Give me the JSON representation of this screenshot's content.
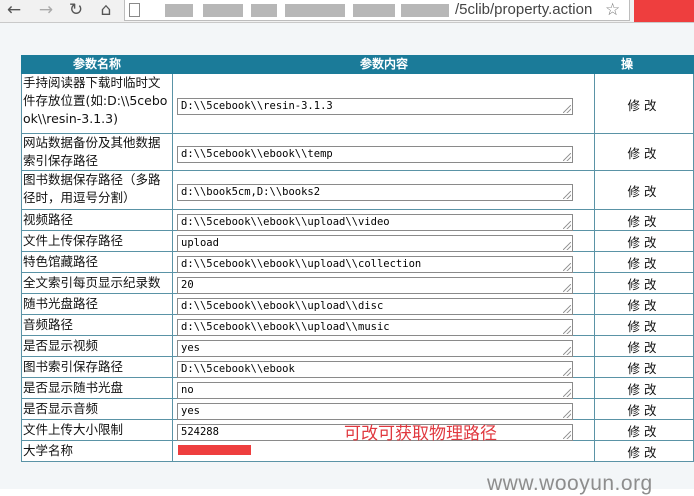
{
  "browser": {
    "back_glyph": "←",
    "forward_glyph": "→",
    "reload_glyph": "↻",
    "home_glyph": "⌂",
    "url_visible": "/5clib/property.action",
    "star_glyph": "☆"
  },
  "table": {
    "headers": [
      "参数名称",
      "参数内容",
      "操"
    ],
    "rows": [
      {
        "name": "手持阅读器下载时临时文件存放位置(如:D:\\\\5cebook\\\\resin-3.1.3)",
        "value": "D:\\\\5cebook\\\\resin-3.1.3",
        "op": "修改"
      },
      {
        "name": "网站数据备份及其他数据索引保存路径",
        "value": "d:\\\\5cebook\\\\ebook\\\\temp",
        "op": "修改"
      },
      {
        "name": "图书数据保存路径（多路径时，用逗号分割）",
        "value": "d:\\\\book5cm,D:\\\\books2",
        "op": "修改"
      },
      {
        "name": "视频路径",
        "value": "d:\\\\5cebook\\\\ebook\\\\upload\\\\video",
        "op": "修改"
      },
      {
        "name": "文件上传保存路径",
        "value": "upload",
        "op": "修改"
      },
      {
        "name": "特色馆藏路径",
        "value": "d:\\\\5cebook\\\\ebook\\\\upload\\\\collection",
        "op": "修改"
      },
      {
        "name": "全文索引每页显示纪录数",
        "value": "20",
        "op": "修改"
      },
      {
        "name": "随书光盘路径",
        "value": "d:\\\\5cebook\\\\ebook\\\\upload\\\\disc",
        "op": "修改"
      },
      {
        "name": "音频路径",
        "value": "d:\\\\5cebook\\\\ebook\\\\upload\\\\music",
        "op": "修改"
      },
      {
        "name": "是否显示视频",
        "value": "yes",
        "op": "修改"
      },
      {
        "name": "图书索引保存路径",
        "value": "D:\\\\5cebook\\\\ebook",
        "op": "修改"
      },
      {
        "name": "是否显示随书光盘",
        "value": "no",
        "op": "修改"
      },
      {
        "name": "是否显示音频",
        "value": "yes",
        "op": "修改"
      },
      {
        "name": "文件上传大小限制",
        "value": "524288",
        "op": "修改"
      },
      {
        "name": "大学名称",
        "value": "",
        "op": "修改"
      }
    ]
  },
  "annotation": "可改可获取物理路径",
  "watermark": "www.wooyun.org",
  "colors": {
    "header_bg": "#1b7b99",
    "annotation": "#e0383f",
    "redaction": "#ee3e3e"
  }
}
